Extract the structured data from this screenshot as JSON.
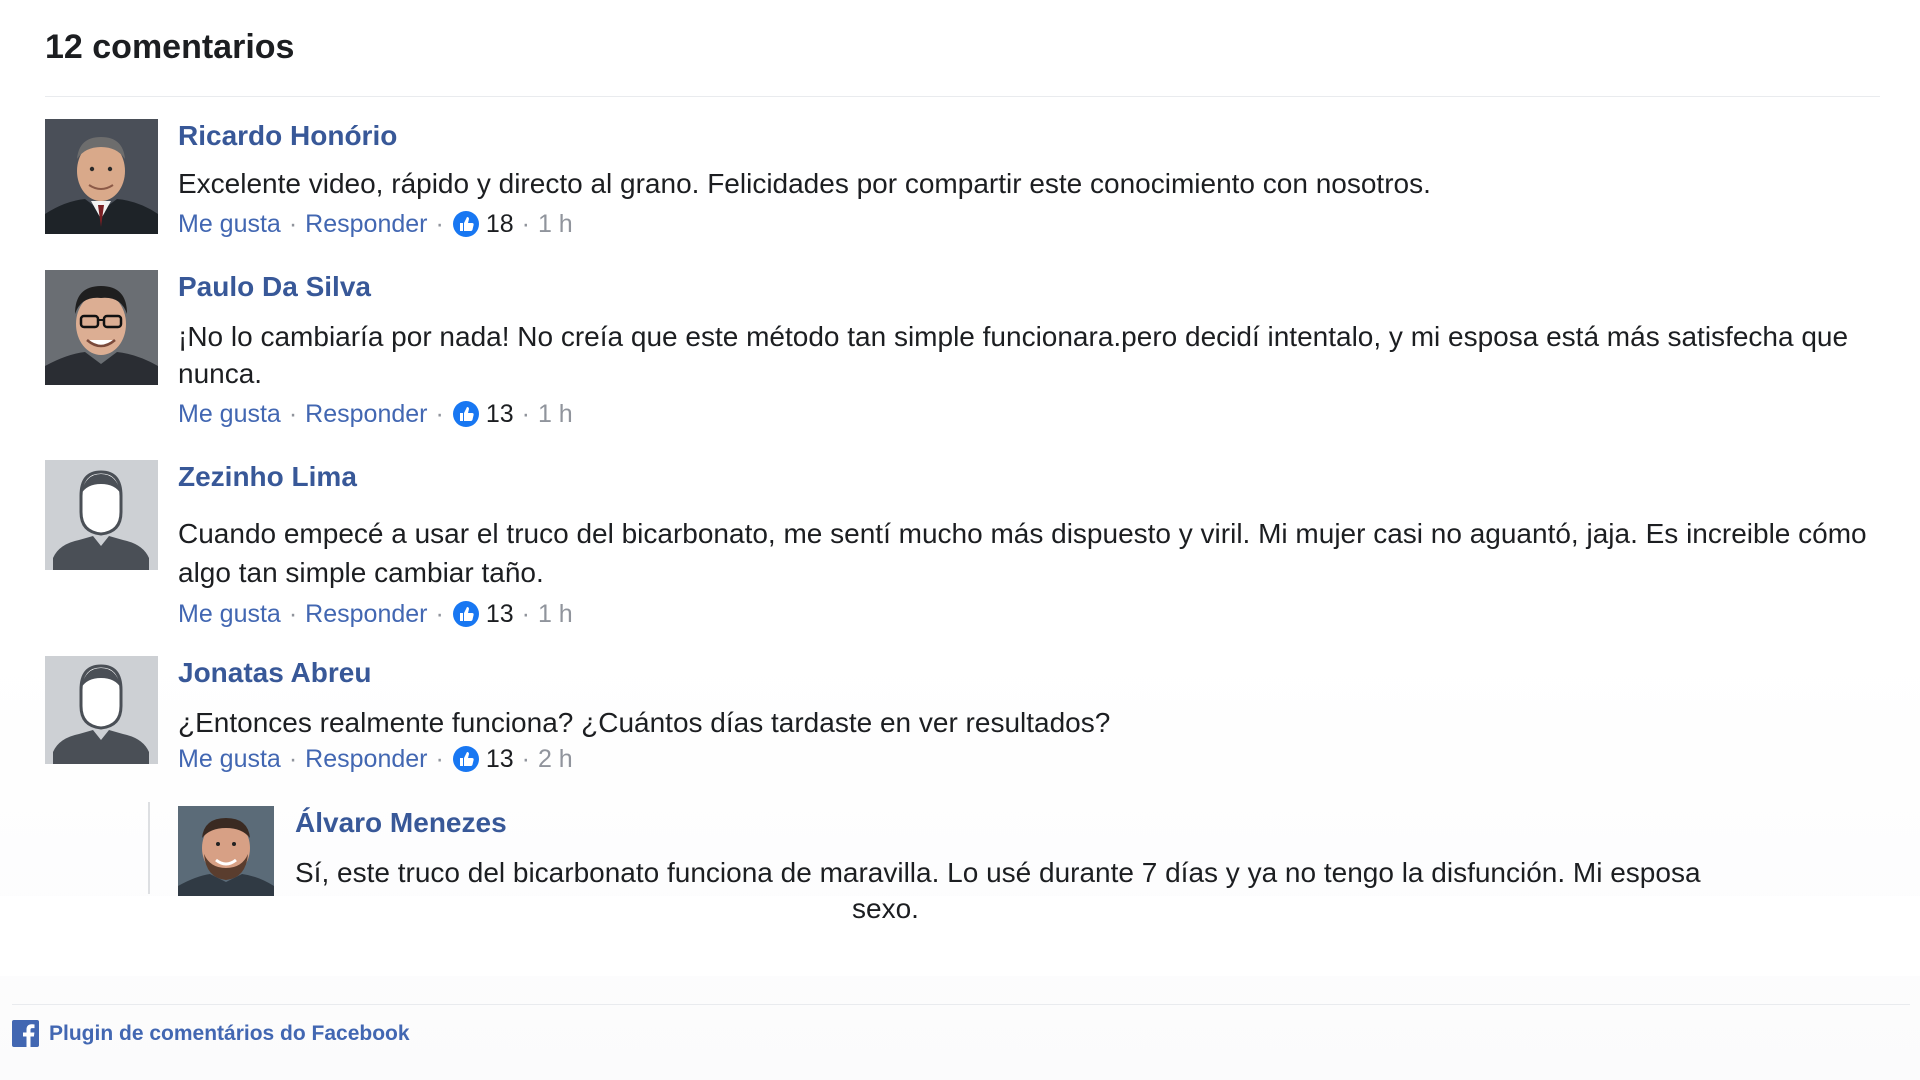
{
  "header": {
    "title": "12 comentarios"
  },
  "comments": [
    {
      "author": "Ricardo Honório",
      "text": "Excelente video, rápido y directo al grano. Felicidades por compartir este conocimiento con nosotros.",
      "like_label": "Me gusta",
      "reply_label": "Responder",
      "likes": "18",
      "time": "1 h",
      "avatar": "photo-man-suit"
    },
    {
      "author": "Paulo Da Silva",
      "text": "¡No lo cambiaría por nada! No creía que este método tan simple funcionara.pero decidí intentalo, y mi esposa está más satisfecha que nunca.",
      "like_label": "Me gusta",
      "reply_label": "Responder",
      "likes": "13",
      "time": "1 h",
      "avatar": "photo-man-glasses"
    },
    {
      "author": "Zezinho Lima",
      "text": "Cuando empecé a usar el truco del bicarbonato, me sentí mucho más dispuesto y viril. Mi mujer casi no aguantó, jaja. Es increible cómo algo tan simple cambiar taño.",
      "like_label": "Me gusta",
      "reply_label": "Responder",
      "likes": "13",
      "time": "1 h",
      "avatar": "default-user-silhouette"
    },
    {
      "author": "Jonatas Abreu",
      "text": "¿Entonces realmente funciona? ¿Cuántos días tardaste en ver resultados?",
      "like_label": "Me gusta",
      "reply_label": "Responder",
      "likes": "13",
      "time": "2 h",
      "avatar": "default-user-silhouette"
    }
  ],
  "reply": {
    "author": "Álvaro Menezes",
    "text": "Sí, este truco del bicarbonato funciona de maravilla. Lo usé durante 7 días y ya no tengo la disfunción. Mi esposa",
    "overflow_text": "sexo.",
    "avatar": "photo-man-beard"
  },
  "footer": {
    "label": "Plugin de comentários do Facebook",
    "icon": "facebook-icon"
  },
  "colors": {
    "author_link": "#385898",
    "action_link": "#4267b2",
    "meta_gray": "#90949c",
    "like_blue": "#1877f2"
  }
}
